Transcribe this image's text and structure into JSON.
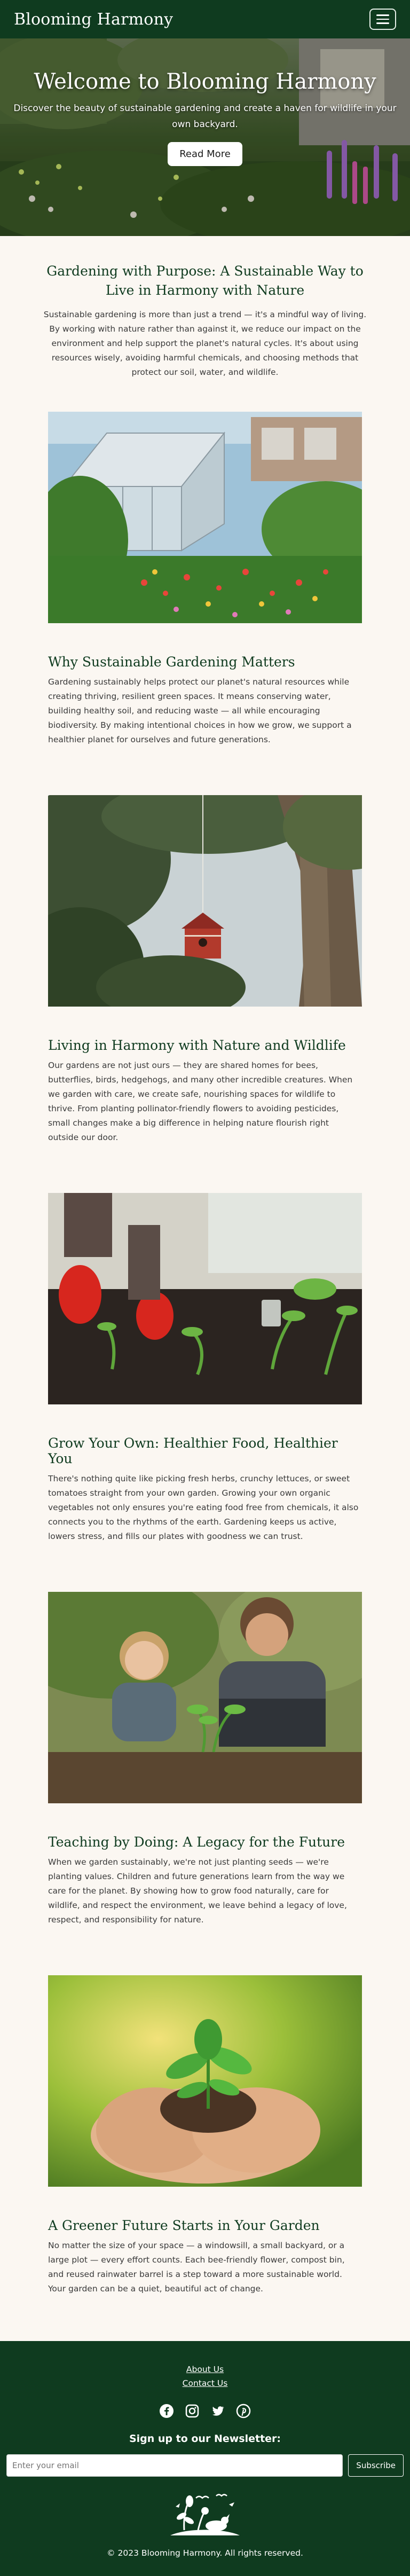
{
  "header": {
    "brand": "Blooming Harmony",
    "menu_icon": "hamburger-menu-icon"
  },
  "hero": {
    "title": "Welcome to Blooming Harmony",
    "subtitle": "Discover the beauty of sustainable gardening and create a haven for wildlife in your own backyard.",
    "button": "Read More"
  },
  "intro": {
    "title": "Gardening with Purpose: A Sustainable Way to Live in Harmony with Nature",
    "body": "Sustainable gardening is more than just a trend — it's a mindful way of living. By working with nature rather than against it, we reduce our impact on the environment and help support the planet's natural cycles. It's about using resources wisely, avoiding harmful chemicals, and choosing methods that protect our soil, water, and wildlife."
  },
  "sections": [
    {
      "image": "greenhouse-garden-image",
      "title": "Why Sustainable Gardening Matters",
      "body": "Gardening sustainably helps protect our planet's natural resources while creating thriving, resilient green spaces. It means conserving water, building healthy soil, and reducing waste — all while encouraging biodiversity. By making intentional choices in how we grow, we support a healthier planet for ourselves and future generations."
    },
    {
      "image": "birdhouse-in-tree-image",
      "title": "Living in Harmony with Nature and Wildlife",
      "body": "Our gardens are not just ours — they are shared homes for bees, butterflies, birds, hedgehogs, and many other incredible creatures. When we garden with care, we create safe, nourishing spaces for wildlife to thrive. From planting pollinator-friendly flowers to avoiding pesticides, small changes make a big difference in helping nature flourish right outside our door."
    },
    {
      "image": "planting-seedlings-image",
      "title": "Grow Your Own: Healthier Food, Healthier You",
      "body": "There's nothing quite like picking fresh herbs, crunchy lettuces, or sweet tomatoes straight from your own garden. Growing your own organic vegetables not only ensures you're eating food free from chemicals, it also connects you to the rhythms of the earth. Gardening keeps us active, lowers stress, and fills our plates with goodness we can trust."
    },
    {
      "image": "father-and-child-gardening-image",
      "title": "Teaching by Doing: A Legacy for the Future",
      "body": "When we garden sustainably, we're not just planting seeds — we're planting values. Children and future generations learn from the way we care for the planet. By showing how to grow food naturally, care for wildlife, and respect the environment, we leave behind a legacy of love, respect, and responsibility for nature."
    },
    {
      "image": "hands-holding-sprout-image",
      "title": "A Greener Future Starts in Your Garden",
      "body": "No matter the size of your space — a windowsill, a small backyard, or a large plot — every effort counts. Each bee-friendly flower, compost bin, and reused rainwater barrel is a step toward a more sustainable world. Your garden can be a quiet, beautiful act of change."
    }
  ],
  "footer": {
    "links": [
      "About Us",
      "Contact Us"
    ],
    "social_icons": [
      "facebook-icon",
      "instagram-icon",
      "twitter-icon",
      "pinterest-icon"
    ],
    "newsletter_title": "Sign up to our Newsletter:",
    "email_placeholder": "Enter your email",
    "subscribe": "Subscribe",
    "logo": "blooming-harmony-logo",
    "copyright": "© 2023 Blooming Harmony. All rights reserved."
  },
  "colors": {
    "primary_green": "#0f3b1f",
    "page_background": "#fbf7f2",
    "white": "#ffffff"
  }
}
